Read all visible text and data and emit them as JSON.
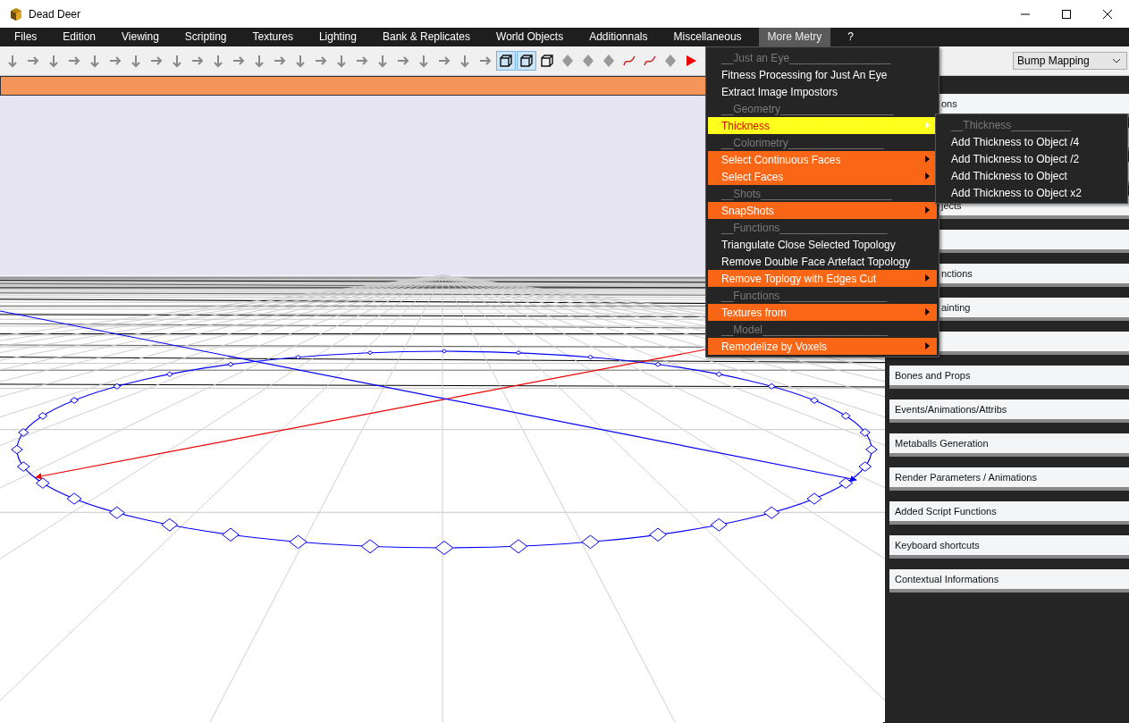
{
  "window": {
    "title": "Dead Deer"
  },
  "menubar": [
    {
      "label": "Files",
      "selected": false
    },
    {
      "label": "Edition",
      "selected": false
    },
    {
      "label": "Viewing",
      "selected": false
    },
    {
      "label": "Scripting",
      "selected": false
    },
    {
      "label": "Textures",
      "selected": false
    },
    {
      "label": "Lighting",
      "selected": false
    },
    {
      "label": "Bank & Replicates",
      "selected": false
    },
    {
      "label": "World Objects",
      "selected": false
    },
    {
      "label": "Additionnals",
      "selected": false
    },
    {
      "label": "Miscellaneous",
      "selected": false
    },
    {
      "label": "More Metry",
      "selected": true
    },
    {
      "label": "?",
      "selected": false
    }
  ],
  "toolbar": {
    "tools": [
      {
        "kind": "arrow",
        "selected": false
      },
      {
        "kind": "arrow",
        "selected": false
      },
      {
        "kind": "arrow",
        "selected": false
      },
      {
        "kind": "arrow",
        "selected": false
      },
      {
        "kind": "arrow",
        "selected": false
      },
      {
        "kind": "arrow",
        "selected": false
      },
      {
        "kind": "arrow",
        "selected": false
      },
      {
        "kind": "arrow",
        "selected": false
      },
      {
        "kind": "arrow",
        "selected": false
      },
      {
        "kind": "arrow",
        "selected": false
      },
      {
        "kind": "arrow",
        "selected": false
      },
      {
        "kind": "arrow",
        "selected": false
      },
      {
        "kind": "arrow",
        "selected": false
      },
      {
        "kind": "arrow",
        "selected": false
      },
      {
        "kind": "arrow",
        "selected": false
      },
      {
        "kind": "arrow",
        "selected": false
      },
      {
        "kind": "arrow",
        "selected": false
      },
      {
        "kind": "arrow",
        "selected": false
      },
      {
        "kind": "arrow",
        "selected": false
      },
      {
        "kind": "arrow",
        "selected": false
      },
      {
        "kind": "arrow",
        "selected": false
      },
      {
        "kind": "arrow",
        "selected": false
      },
      {
        "kind": "arrow",
        "selected": false
      },
      {
        "kind": "arrow",
        "selected": false
      },
      {
        "kind": "cube",
        "selected": true
      },
      {
        "kind": "cube",
        "selected": true
      },
      {
        "kind": "cube",
        "selected": false
      },
      {
        "kind": "shape",
        "selected": false
      },
      {
        "kind": "shape",
        "selected": false
      },
      {
        "kind": "shape",
        "selected": false
      },
      {
        "kind": "curve",
        "selected": false
      },
      {
        "kind": "curve",
        "selected": false
      },
      {
        "kind": "shape",
        "selected": false
      },
      {
        "kind": "play",
        "selected": false
      }
    ],
    "render_mode": "Bump Mapping"
  },
  "menu": {
    "items": [
      {
        "kind": "header",
        "label": "__Just an Eye_________________"
      },
      {
        "kind": "item",
        "label": "Fitness Processing for Just An Eye"
      },
      {
        "kind": "item",
        "label": "Extract Image Impostors"
      },
      {
        "kind": "header",
        "label": "__Geometry___________________"
      },
      {
        "kind": "submenu",
        "label": "Thickness",
        "selected": true
      },
      {
        "kind": "header",
        "label": "__Colorimetry________________"
      },
      {
        "kind": "submenu",
        "label": "Select Continuous Faces",
        "selected": false
      },
      {
        "kind": "submenu",
        "label": "Select Faces",
        "selected": false
      },
      {
        "kind": "header",
        "label": "__Shots______________________"
      },
      {
        "kind": "submenu",
        "label": "SnapShots",
        "selected": false
      },
      {
        "kind": "header",
        "label": "__Functions__________________"
      },
      {
        "kind": "item",
        "label": "Triangulate Close Selected Topology"
      },
      {
        "kind": "item",
        "label": "Remove Double Face Artefact Topology"
      },
      {
        "kind": "submenu",
        "label": "Remove Toplogy with Edges Cut",
        "selected": false
      },
      {
        "kind": "header",
        "label": "__Functions__________________"
      },
      {
        "kind": "submenu",
        "label": "Textures from",
        "selected": false
      },
      {
        "kind": "header",
        "label": "__Model_____________________"
      },
      {
        "kind": "submenu",
        "label": "Remodelize by Voxels",
        "selected": false
      }
    ]
  },
  "submenu": {
    "items": [
      {
        "kind": "header",
        "label": "__Thickness__________"
      },
      {
        "kind": "item",
        "label": "Add Thickness to Object /4"
      },
      {
        "kind": "item",
        "label": "Add Thickness to Object /2"
      },
      {
        "kind": "item",
        "label": "Add Thickness to Object"
      },
      {
        "kind": "item",
        "label": "Add Thickness to Object x2"
      }
    ]
  },
  "panel": {
    "sections": [
      {
        "kind": "clipped",
        "label": "ons"
      },
      {
        "kind": "blank"
      },
      {
        "kind": "blank"
      },
      {
        "kind": "clipped",
        "label": "jects"
      },
      {
        "kind": "blank"
      },
      {
        "kind": "clipped",
        "label": "nctions"
      },
      {
        "kind": "clipped",
        "label": "ainting"
      },
      {
        "kind": "blank"
      },
      {
        "kind": "full",
        "label": "Bones and Props"
      },
      {
        "kind": "full",
        "label": "Events/Animations/Attribs"
      },
      {
        "kind": "full",
        "label": "Metaballs Generation"
      },
      {
        "kind": "full",
        "label": "Render Parameters / Animations"
      },
      {
        "kind": "full",
        "label": "Added Script Functions"
      },
      {
        "kind": "full",
        "label": "Keyboard shortcuts"
      },
      {
        "kind": "full",
        "label": "Contextual Informations"
      }
    ]
  }
}
